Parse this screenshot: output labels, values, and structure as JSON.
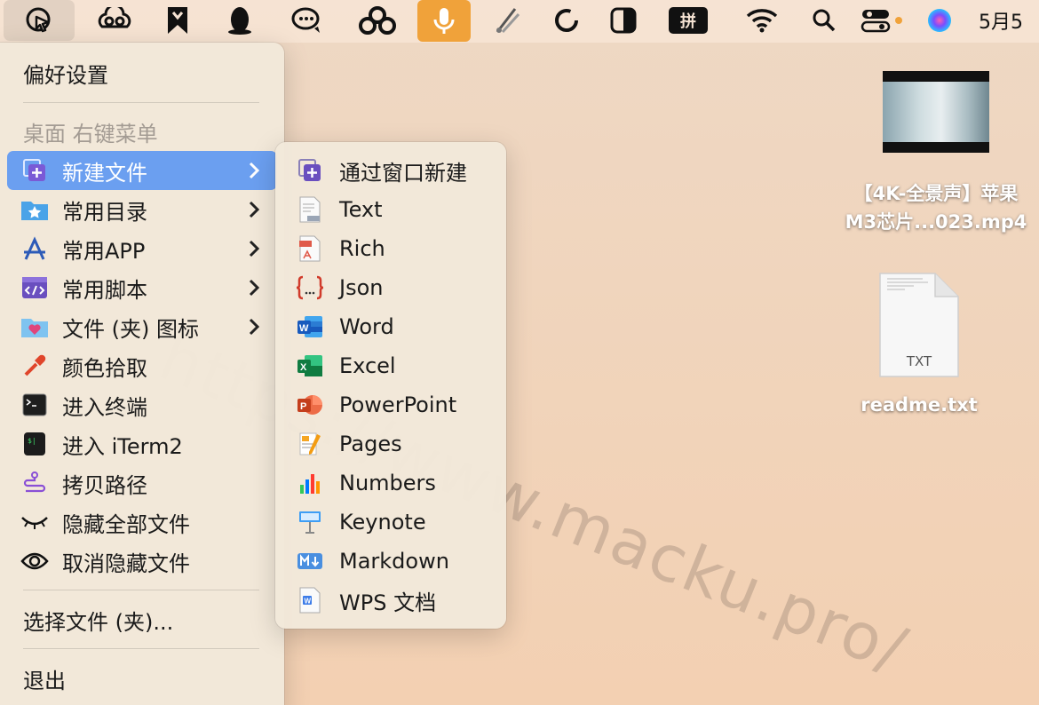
{
  "menubar": {
    "date_text": "5月5",
    "ime_label": "拼",
    "icons": [
      "cursor-select-icon",
      "creative-cloud-icon",
      "bookmark-app-icon",
      "qq-penguin-icon",
      "chat-bubble-icon",
      "baidu-netdisk-icon",
      "microphone-icon",
      "palette-app-icon",
      "refresh-icon",
      "display-contrast-icon",
      "input-method-icon",
      "wifi-icon",
      "search-icon",
      "control-center-icon",
      "siri-icon"
    ],
    "accent_color": "#f0a23a"
  },
  "main_menu": {
    "preferences": "偏好设置",
    "section_header": "桌面 右键菜单",
    "items": [
      {
        "label": "新建文件",
        "icon": "new-file-icon",
        "submenu": true,
        "selected": true
      },
      {
        "label": "常用目录",
        "icon": "favorite-folder-icon",
        "submenu": true
      },
      {
        "label": "常用APP",
        "icon": "app-store-icon",
        "submenu": true
      },
      {
        "label": "常用脚本",
        "icon": "script-icon",
        "submenu": true
      },
      {
        "label": "文件 (夹) 图标",
        "icon": "folder-heart-icon",
        "submenu": true
      },
      {
        "label": "颜色拾取",
        "icon": "eyedropper-icon"
      },
      {
        "label": "进入终端",
        "icon": "terminal-icon"
      },
      {
        "label": "进入 iTerm2",
        "icon": "iterm-icon"
      },
      {
        "label": "拷贝路径",
        "icon": "copy-path-icon"
      },
      {
        "label": "隐藏全部文件",
        "icon": "eye-closed-icon"
      },
      {
        "label": "取消隐藏文件",
        "icon": "eye-open-icon"
      }
    ],
    "choose_file": "选择文件 (夹)...",
    "quit": "退出",
    "selected_color": "#6b9ff0"
  },
  "sub_menu": {
    "items": [
      {
        "label": "通过窗口新建",
        "icon": "new-window-file-icon"
      },
      {
        "label": "Text",
        "icon": "txt-file-icon"
      },
      {
        "label": "Rich",
        "icon": "rtf-file-icon"
      },
      {
        "label": "Json",
        "icon": "json-braces-icon"
      },
      {
        "label": "Word",
        "icon": "word-icon"
      },
      {
        "label": "Excel",
        "icon": "excel-icon"
      },
      {
        "label": "PowerPoint",
        "icon": "powerpoint-icon"
      },
      {
        "label": "Pages",
        "icon": "pages-icon"
      },
      {
        "label": "Numbers",
        "icon": "numbers-icon"
      },
      {
        "label": "Keynote",
        "icon": "keynote-icon"
      },
      {
        "label": "Markdown",
        "icon": "markdown-icon"
      },
      {
        "label": "WPS 文档",
        "icon": "wps-doc-icon"
      }
    ]
  },
  "desktop": {
    "video_file": {
      "line1": "【4K-全景声】苹果",
      "line2": "M3芯片...023.mp4"
    },
    "text_file": {
      "name": "readme.txt",
      "badge": "TXT"
    }
  },
  "watermark": "https://www.macku.pro/"
}
